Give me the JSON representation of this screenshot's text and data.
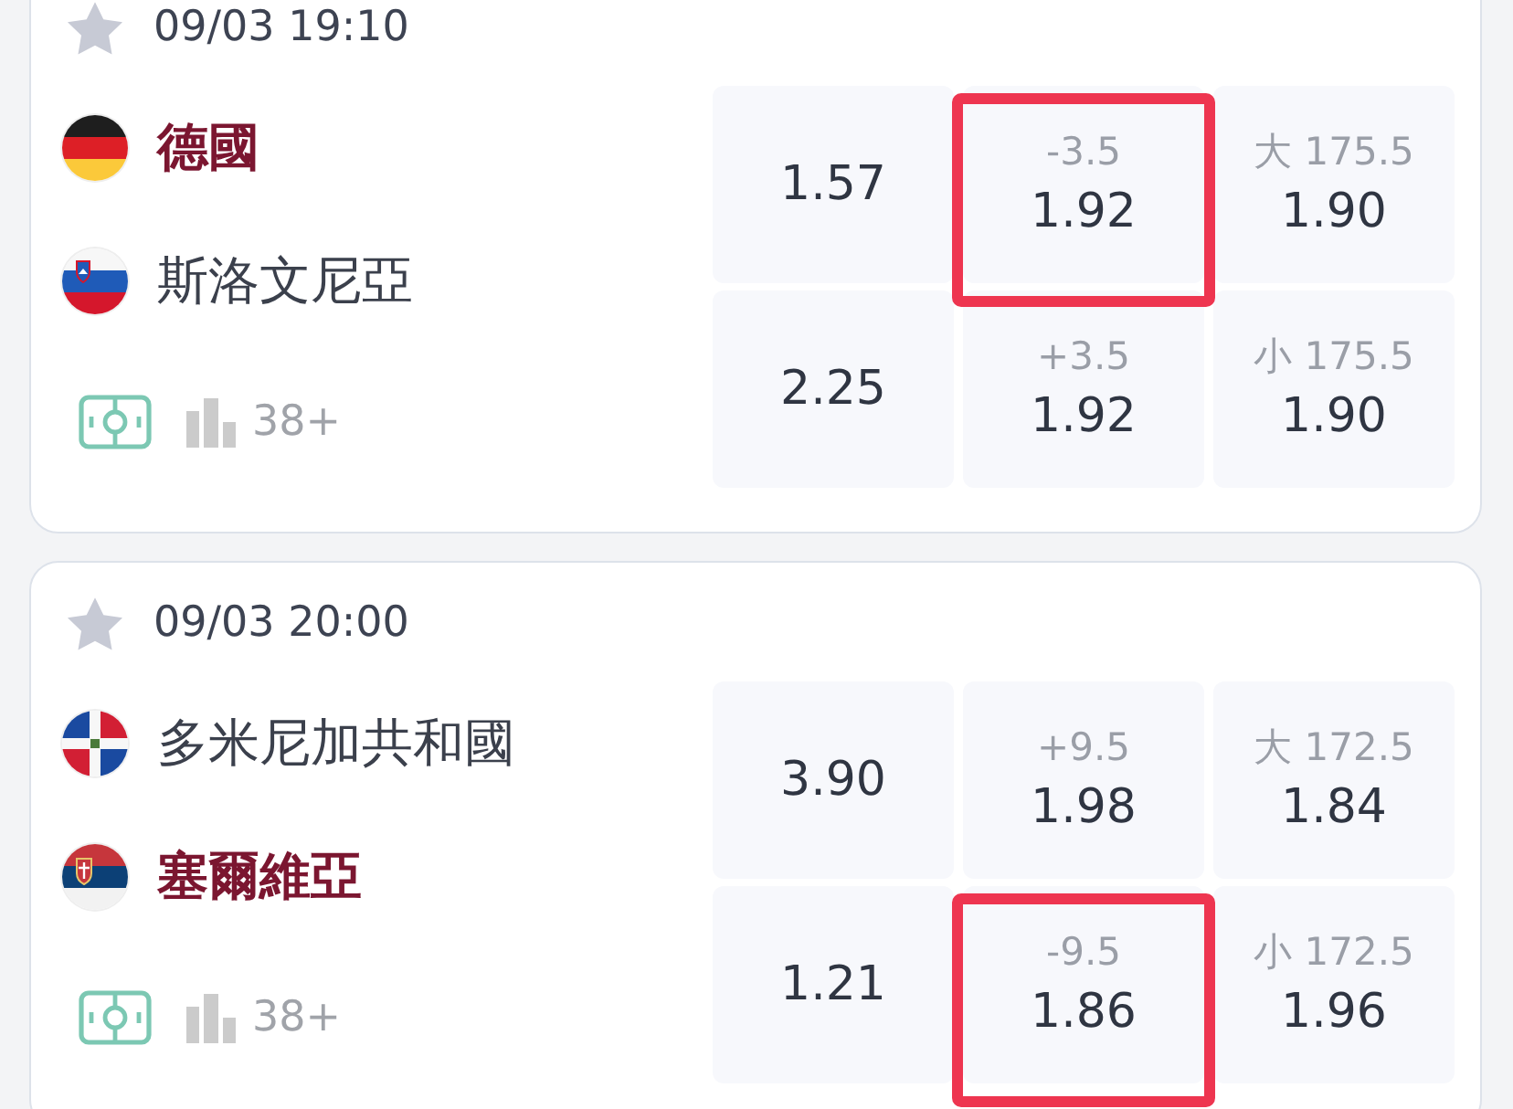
{
  "matches": [
    {
      "starred": false,
      "time": "09/03 19:10",
      "teams": [
        {
          "name": "德國",
          "emphasized": true
        },
        {
          "name": "斯洛文尼亞",
          "emphasized": false
        }
      ],
      "market_count": "38+",
      "rows": [
        {
          "cells": [
            {
              "kind": "moneyline",
              "odds": "1.57",
              "highlighted": false
            },
            {
              "kind": "handicap",
              "line": "-3.5",
              "odds": "1.92",
              "highlighted": true
            },
            {
              "kind": "total",
              "line": "大 175.5",
              "odds": "1.90",
              "highlighted": false
            }
          ]
        },
        {
          "cells": [
            {
              "kind": "moneyline",
              "odds": "2.25",
              "highlighted": false
            },
            {
              "kind": "handicap",
              "line": "+3.5",
              "odds": "1.92",
              "highlighted": false
            },
            {
              "kind": "total",
              "line": "小 175.5",
              "odds": "1.90",
              "highlighted": false
            }
          ]
        }
      ]
    },
    {
      "starred": false,
      "time": "09/03 20:00",
      "teams": [
        {
          "name": "多米尼加共和國",
          "emphasized": false
        },
        {
          "name": "塞爾維亞",
          "emphasized": true
        }
      ],
      "market_count": "38+",
      "rows": [
        {
          "cells": [
            {
              "kind": "moneyline",
              "odds": "3.90",
              "highlighted": false
            },
            {
              "kind": "handicap",
              "line": "+9.5",
              "odds": "1.98",
              "highlighted": false
            },
            {
              "kind": "total",
              "line": "大 172.5",
              "odds": "1.84",
              "highlighted": false
            }
          ]
        },
        {
          "cells": [
            {
              "kind": "moneyline",
              "odds": "1.21",
              "highlighted": false
            },
            {
              "kind": "handicap",
              "line": "-9.5",
              "odds": "1.86",
              "highlighted": true
            },
            {
              "kind": "total",
              "line": "小 172.5",
              "odds": "1.96",
              "highlighted": false
            }
          ]
        }
      ]
    }
  ]
}
